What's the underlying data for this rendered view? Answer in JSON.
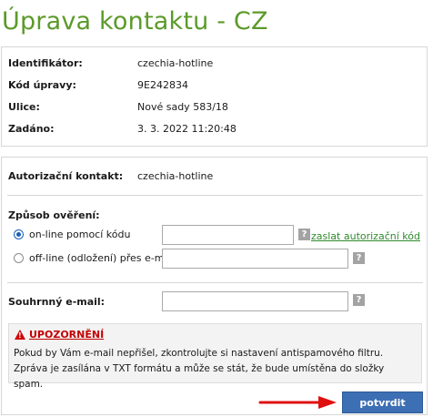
{
  "page_title": "Úprava kontaktu - CZ",
  "details": [
    {
      "label": "Identifikátor:",
      "value": "czechia-hotline"
    },
    {
      "label": "Kód úpravy:",
      "value": "9E242834"
    },
    {
      "label": "Ulice:",
      "value": "Nové sady 583/18"
    },
    {
      "label": "Zadáno:",
      "value": "3. 3. 2022 11:20:48"
    }
  ],
  "auth_contact": {
    "label": "Autorizační kontakt:",
    "value": "czechia-hotline"
  },
  "verification": {
    "heading": "Způsob ověření:",
    "online_label": "on-line pomocí kódu",
    "offline_label": "off-line (odložení) přes e-mail",
    "send_code_link": "zaslat autorizační kód",
    "code_value": "",
    "email_value": "",
    "selected": "online"
  },
  "summary_email": {
    "label": "Souhrnný e-mail:",
    "value": ""
  },
  "help_glyph": "?",
  "warning": {
    "title": "UPOZORNĚNÍ",
    "text": "Pokud by Vám e-mail nepřišel, zkontrolujte si nastavení antispamového filtru. Zpráva je zasílána v TXT formátu a může se stát, že bude umístěna do složky spam."
  },
  "confirm_button": "potvrdit",
  "colors": {
    "title_green": "#5b9a2a",
    "link_green": "#2e8b2e",
    "button_blue": "#3d6fb4",
    "warning_red": "#c40000",
    "arrow_red": "#e01010"
  },
  "icons": [
    "help-icon",
    "warning-triangle-icon",
    "arrow-right-icon"
  ]
}
